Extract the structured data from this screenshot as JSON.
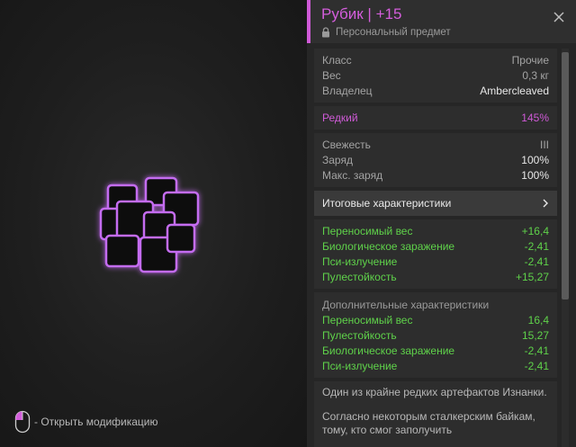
{
  "item": {
    "title": "Рубик | +15",
    "subtitle": "Персональный предмет"
  },
  "info": [
    {
      "label": "Класс",
      "value": "Прочие"
    },
    {
      "label": "Вес",
      "value": "0,3 кг"
    },
    {
      "label": "Владелец",
      "value": "Ambercleaved"
    }
  ],
  "rarity": {
    "label": "Редкий",
    "value": "145%"
  },
  "condition": [
    {
      "label": "Свежесть",
      "value": "III"
    },
    {
      "label": "Заряд",
      "value": "100%"
    },
    {
      "label": "Макс. заряд",
      "value": "100%"
    }
  ],
  "total_section": {
    "label": "Итоговые характеристики"
  },
  "total_stats": [
    {
      "label": "Переносимый вес",
      "value": "+16,4"
    },
    {
      "label": "Биологическое заражение",
      "value": "-2,41"
    },
    {
      "label": "Пси-излучение",
      "value": "-2,41"
    },
    {
      "label": "Пулестойкость",
      "value": "+15,27"
    }
  ],
  "extra_section": {
    "label": "Дополнительные характеристики"
  },
  "extra_stats": [
    {
      "label": "Переносимый вес",
      "value": "16,4"
    },
    {
      "label": "Пулестойкость",
      "value": "15,27"
    },
    {
      "label": "Биологическое заражение",
      "value": "-2,41"
    },
    {
      "label": "Пси-излучение",
      "value": "-2,41"
    }
  ],
  "description": [
    "Один из крайне редких артефактов Изнанки.",
    "Согласно некоторым сталкерским байкам, тому, кто смог заполучить"
  ],
  "hint": {
    "label": "- Открыть модификацию"
  },
  "colors": {
    "rarity": "#cf5ad7",
    "positive": "#5fd24a",
    "panel_bg": "#262626"
  }
}
